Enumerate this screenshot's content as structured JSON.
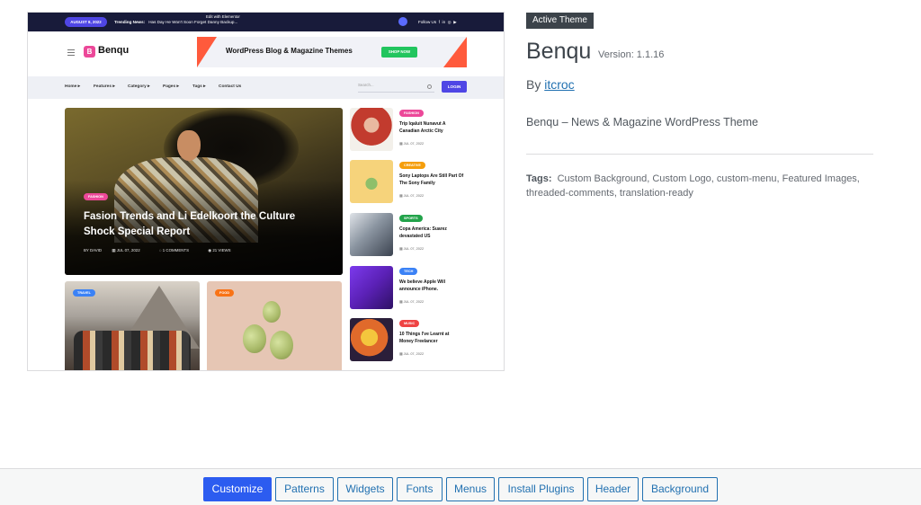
{
  "preview": {
    "topbar": {
      "date": "AUGUST 8, 2022",
      "trending_label": "Trending News:",
      "trending_text": "Has Day He Won't Soon Forget Danny Backup...",
      "elementor_text": "Edit with Elementor",
      "follow_us": "Follow Us"
    },
    "brand": {
      "logo_letter": "B",
      "name": "Benqu"
    },
    "banner": {
      "text": "WordPress Blog & Magazine Themes",
      "button": "SHOP NOW"
    },
    "nav": {
      "items": [
        "Home",
        "Features",
        "Category",
        "Pages",
        "Tags",
        "Contact Us"
      ],
      "search_placeholder": "Search...",
      "login": "LOGIN"
    },
    "hero": {
      "category": "FASHION",
      "title": "Fasion Trends and Li Edelkoort the Culture Shock Special Report",
      "author": "BY DAVID",
      "date": "JUL 07, 2022",
      "comments": "1 COMMENTS",
      "views": "21 VIEWS"
    },
    "cards": [
      {
        "category": "TRAVEL"
      },
      {
        "category": "FOOD"
      }
    ],
    "side_posts": [
      {
        "category": "FASHION",
        "title": "Trip Iqaluit Nunavut A Canadian Arctic City",
        "date": "JUL 07, 2022",
        "cat_color": "#ec4899"
      },
      {
        "category": "CREATIVE",
        "title": "Sony Laptops Are Still Part Of The Sony Family",
        "date": "JUL 07, 2022",
        "cat_color": "#f59e0b"
      },
      {
        "category": "SPORTS",
        "title": "Copa America: Suarez devastated US",
        "date": "JUL 07, 2022",
        "cat_color": "#22a34a"
      },
      {
        "category": "TECH",
        "title": "We believe Apple Will announce iPhone.",
        "date": "JUL 07, 2022",
        "cat_color": "#3b82f6"
      },
      {
        "category": "MUSIC",
        "title": "10 Things I've Learnt at Money Freelancer",
        "date": "JUL 07, 2022",
        "cat_color": "#ef4444"
      }
    ]
  },
  "theme": {
    "badge": "Active Theme",
    "name": "Benqu",
    "version": "Version: 1.1.16",
    "author_prefix": "By",
    "author": "itcroc",
    "description": "Benqu – News & Magazine WordPress Theme",
    "tags_label": "Tags:",
    "tags": "Custom Background, Custom Logo, custom-menu, Featured Images, threaded-comments, translation-ready"
  },
  "actions": {
    "buttons": [
      "Customize",
      "Patterns",
      "Widgets",
      "Fonts",
      "Menus",
      "Install Plugins",
      "Header",
      "Background"
    ]
  },
  "colors": {
    "primary": "#2c5cf0",
    "link": "#2271b1",
    "badge_bg": "#3c434a"
  }
}
